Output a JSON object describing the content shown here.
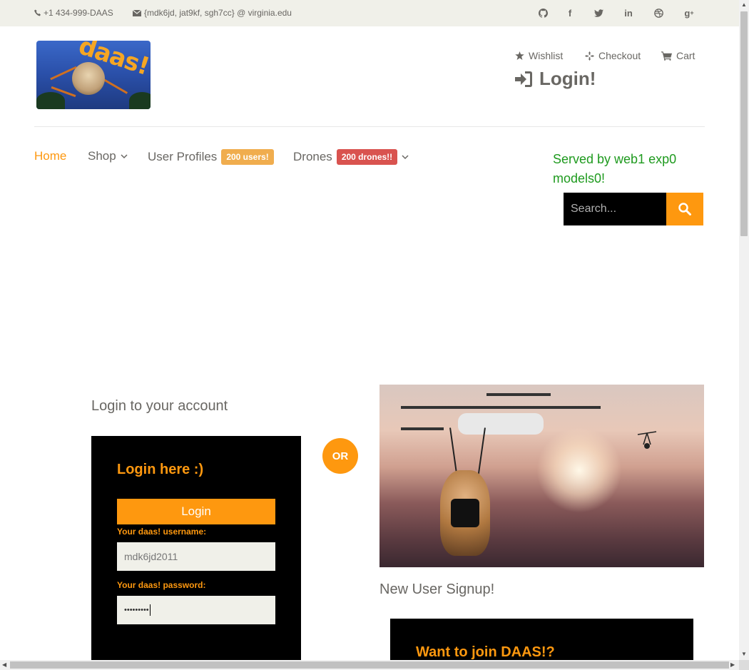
{
  "topbar": {
    "phone": "+1 434-999-DAAS",
    "email": "{mdk6jd, jat9kf, sgh7cc} @ virginia.edu",
    "social_icons": [
      "github-icon",
      "facebook-icon",
      "twitter-icon",
      "linkedin-icon",
      "dribbble-icon",
      "google-plus-icon"
    ]
  },
  "header": {
    "logo_text": "daas!",
    "shop_menu": [
      {
        "label": "Wishlist",
        "icon": "star-icon"
      },
      {
        "label": "Checkout",
        "icon": "crosshairs-icon"
      },
      {
        "label": "Cart",
        "icon": "cart-icon"
      }
    ],
    "login_label": "Login!"
  },
  "nav": {
    "home": "Home",
    "shop": "Shop",
    "user_profiles": "User Profiles",
    "user_badge": "200 users!",
    "drones": "Drones",
    "drones_badge": "200 drones!!"
  },
  "served_by": "Served by web1 exp0 models0!",
  "search": {
    "placeholder": "Search..."
  },
  "login": {
    "title": "Login to your account",
    "heading": "Login here :)",
    "button": "Login",
    "username_label": "Your daas! username:",
    "username_value": "mdk6jd2011",
    "password_label": "Your daas! password:",
    "password_value": "•••••••••"
  },
  "or_label": "OR",
  "signup": {
    "title": "New User Signup!",
    "heading": "Want to join DAAS!?"
  },
  "colors": {
    "accent": "#fe980f",
    "served": "#1e9a1e",
    "badge_orange": "#f0ad4e",
    "badge_red": "#d9534f"
  }
}
